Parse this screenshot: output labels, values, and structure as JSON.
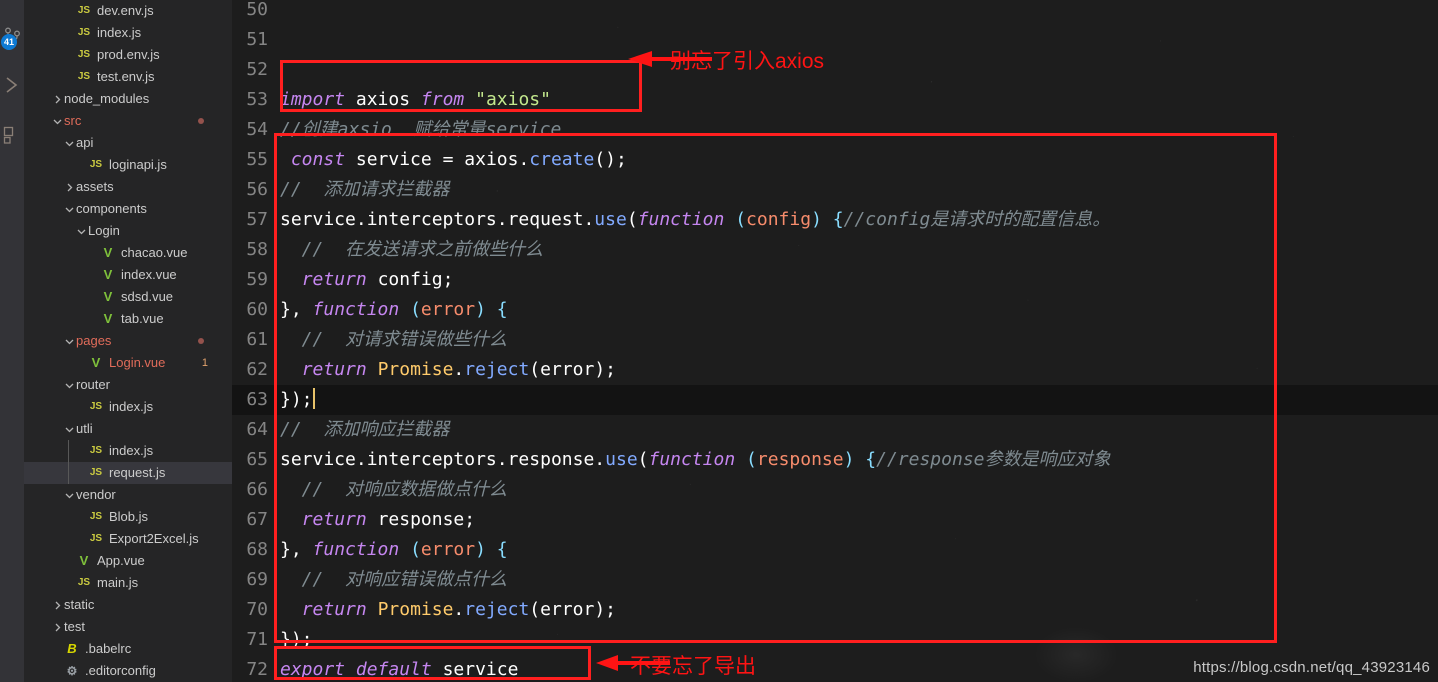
{
  "activity_bar": {
    "items": [
      {
        "name": "source-control-icon",
        "badge": "41"
      },
      {
        "name": "run-debug-icon",
        "badge": ""
      },
      {
        "name": "extensions-icon",
        "badge": ""
      }
    ]
  },
  "sidebar": {
    "items": [
      {
        "label": "dev.env.js",
        "indent": 3,
        "icon": "js",
        "twisty": "",
        "state": "",
        "badge": "",
        "dot": false
      },
      {
        "label": "index.js",
        "indent": 3,
        "icon": "js",
        "twisty": "",
        "state": "",
        "badge": "",
        "dot": false
      },
      {
        "label": "prod.env.js",
        "indent": 3,
        "icon": "js",
        "twisty": "",
        "state": "",
        "badge": "",
        "dot": false
      },
      {
        "label": "test.env.js",
        "indent": 3,
        "icon": "js",
        "twisty": "",
        "state": "",
        "badge": "",
        "dot": false
      },
      {
        "label": "node_modules",
        "indent": 2,
        "icon": "",
        "twisty": "collapsed",
        "state": "",
        "badge": "",
        "dot": false
      },
      {
        "label": "src",
        "indent": 2,
        "icon": "",
        "twisty": "expanded",
        "state": "gitmod",
        "badge": "",
        "dot": true
      },
      {
        "label": "api",
        "indent": 3,
        "icon": "",
        "twisty": "expanded",
        "state": "",
        "badge": "",
        "dot": false
      },
      {
        "label": "loginapi.js",
        "indent": 4,
        "icon": "js",
        "twisty": "",
        "state": "",
        "badge": "",
        "dot": false
      },
      {
        "label": "assets",
        "indent": 3,
        "icon": "",
        "twisty": "collapsed",
        "state": "",
        "badge": "",
        "dot": false
      },
      {
        "label": "components",
        "indent": 3,
        "icon": "",
        "twisty": "expanded",
        "state": "",
        "badge": "",
        "dot": false
      },
      {
        "label": "Login",
        "indent": 4,
        "icon": "",
        "twisty": "expanded",
        "state": "",
        "badge": "",
        "dot": false
      },
      {
        "label": "chacao.vue",
        "indent": 5,
        "icon": "vue",
        "twisty": "",
        "state": "",
        "badge": "",
        "dot": false
      },
      {
        "label": "index.vue",
        "indent": 5,
        "icon": "vue",
        "twisty": "",
        "state": "",
        "badge": "",
        "dot": false
      },
      {
        "label": "sdsd.vue",
        "indent": 5,
        "icon": "vue",
        "twisty": "",
        "state": "",
        "badge": "",
        "dot": false
      },
      {
        "label": "tab.vue",
        "indent": 5,
        "icon": "vue",
        "twisty": "",
        "state": "",
        "badge": "",
        "dot": false
      },
      {
        "label": "pages",
        "indent": 3,
        "icon": "",
        "twisty": "expanded",
        "state": "gitmod",
        "badge": "",
        "dot": true
      },
      {
        "label": "Login.vue",
        "indent": 4,
        "icon": "vue",
        "twisty": "",
        "state": "gitmod",
        "badge": "1",
        "dot": false
      },
      {
        "label": "router",
        "indent": 3,
        "icon": "",
        "twisty": "expanded",
        "state": "",
        "badge": "",
        "dot": false
      },
      {
        "label": "index.js",
        "indent": 4,
        "icon": "js",
        "twisty": "",
        "state": "",
        "badge": "",
        "dot": false
      },
      {
        "label": "utli",
        "indent": 3,
        "icon": "",
        "twisty": "expanded",
        "state": "",
        "badge": "",
        "dot": false
      },
      {
        "label": "index.js",
        "indent": 4,
        "icon": "js",
        "twisty": "",
        "state": "",
        "badge": "",
        "dot": false
      },
      {
        "label": "request.js",
        "indent": 4,
        "icon": "js",
        "twisty": "",
        "state": "selected",
        "badge": "",
        "dot": false
      },
      {
        "label": "vendor",
        "indent": 3,
        "icon": "",
        "twisty": "expanded",
        "state": "",
        "badge": "",
        "dot": false
      },
      {
        "label": "Blob.js",
        "indent": 4,
        "icon": "js",
        "twisty": "",
        "state": "",
        "badge": "",
        "dot": false
      },
      {
        "label": "Export2Excel.js",
        "indent": 4,
        "icon": "js",
        "twisty": "",
        "state": "",
        "badge": "",
        "dot": false
      },
      {
        "label": "App.vue",
        "indent": 3,
        "icon": "vue",
        "twisty": "",
        "state": "",
        "badge": "",
        "dot": false
      },
      {
        "label": "main.js",
        "indent": 3,
        "icon": "js",
        "twisty": "",
        "state": "",
        "badge": "",
        "dot": false
      },
      {
        "label": "static",
        "indent": 2,
        "icon": "",
        "twisty": "collapsed",
        "state": "",
        "badge": "",
        "dot": false
      },
      {
        "label": "test",
        "indent": 2,
        "icon": "",
        "twisty": "collapsed",
        "state": "",
        "badge": "",
        "dot": false
      },
      {
        "label": ".babelrc",
        "indent": 2,
        "icon": "babel",
        "twisty": "",
        "state": "",
        "badge": "",
        "dot": false
      },
      {
        "label": ".editorconfig",
        "indent": 2,
        "icon": "gear",
        "twisty": "",
        "state": "",
        "badge": "",
        "dot": false
      }
    ]
  },
  "editor": {
    "current_line": 63,
    "lines": [
      {
        "no": "50",
        "tokens": []
      },
      {
        "no": "51",
        "tokens": []
      },
      {
        "no": "52",
        "tokens": []
      },
      {
        "no": "53",
        "tokens": [
          {
            "t": "import",
            "c": "kw"
          },
          {
            "t": " ",
            "c": "op"
          },
          {
            "t": "axios",
            "c": "plain"
          },
          {
            "t": " ",
            "c": "op"
          },
          {
            "t": "from",
            "c": "kw"
          },
          {
            "t": " ",
            "c": "op"
          },
          {
            "t": "\"axios\"",
            "c": "str"
          }
        ]
      },
      {
        "no": "54",
        "tokens": [
          {
            "t": "//创建axsio  赋给常量service",
            "c": "cmt"
          }
        ]
      },
      {
        "no": "55",
        "tokens": [
          {
            "t": " ",
            "c": "op"
          },
          {
            "t": "const",
            "c": "kw"
          },
          {
            "t": " ",
            "c": "op"
          },
          {
            "t": "service",
            "c": "plain"
          },
          {
            "t": " ",
            "c": "op"
          },
          {
            "t": "=",
            "c": "op"
          },
          {
            "t": " ",
            "c": "op"
          },
          {
            "t": "axios",
            "c": "plain"
          },
          {
            "t": ".",
            "c": "op"
          },
          {
            "t": "create",
            "c": "fn"
          },
          {
            "t": "();",
            "c": "plain"
          }
        ]
      },
      {
        "no": "56",
        "tokens": [
          {
            "t": "//  添加请求拦截器",
            "c": "cmt"
          }
        ]
      },
      {
        "no": "57",
        "tokens": [
          {
            "t": "service",
            "c": "plain"
          },
          {
            "t": ".",
            "c": "op"
          },
          {
            "t": "interceptors",
            "c": "plain"
          },
          {
            "t": ".",
            "c": "op"
          },
          {
            "t": "request",
            "c": "plain"
          },
          {
            "t": ".",
            "c": "op"
          },
          {
            "t": "use",
            "c": "fn"
          },
          {
            "t": "(",
            "c": "plain"
          },
          {
            "t": "function",
            "c": "kw"
          },
          {
            "t": " ",
            "c": "op"
          },
          {
            "t": "(",
            "c": "punc"
          },
          {
            "t": "config",
            "c": "param"
          },
          {
            "t": ")",
            "c": "punc"
          },
          {
            "t": " ",
            "c": "op"
          },
          {
            "t": "{",
            "c": "punc"
          },
          {
            "t": "//config是请求时的配置信息。",
            "c": "cmt"
          }
        ]
      },
      {
        "no": "58",
        "tokens": [
          {
            "t": "  //  在发送请求之前做些什么",
            "c": "cmt"
          }
        ]
      },
      {
        "no": "59",
        "tokens": [
          {
            "t": "  ",
            "c": "op"
          },
          {
            "t": "return",
            "c": "kw"
          },
          {
            "t": " ",
            "c": "op"
          },
          {
            "t": "config",
            "c": "plain"
          },
          {
            "t": ";",
            "c": "plain"
          }
        ]
      },
      {
        "no": "60",
        "tokens": [
          {
            "t": "}, ",
            "c": "plain"
          },
          {
            "t": "function",
            "c": "kw"
          },
          {
            "t": " ",
            "c": "op"
          },
          {
            "t": "(",
            "c": "punc"
          },
          {
            "t": "error",
            "c": "param"
          },
          {
            "t": ")",
            "c": "punc"
          },
          {
            "t": " ",
            "c": "op"
          },
          {
            "t": "{",
            "c": "punc"
          }
        ]
      },
      {
        "no": "61",
        "tokens": [
          {
            "t": "  //  对请求错误做些什么",
            "c": "cmt"
          }
        ]
      },
      {
        "no": "62",
        "tokens": [
          {
            "t": "  ",
            "c": "op"
          },
          {
            "t": "return",
            "c": "kw"
          },
          {
            "t": " ",
            "c": "op"
          },
          {
            "t": "Promise",
            "c": "cls"
          },
          {
            "t": ".",
            "c": "op"
          },
          {
            "t": "reject",
            "c": "fn"
          },
          {
            "t": "(error);",
            "c": "plain"
          }
        ]
      },
      {
        "no": "63",
        "tokens": [
          {
            "t": "});",
            "c": "plain"
          }
        ],
        "cursor": true
      },
      {
        "no": "64",
        "tokens": [
          {
            "t": "//  添加响应拦截器",
            "c": "cmt"
          }
        ]
      },
      {
        "no": "65",
        "tokens": [
          {
            "t": "service",
            "c": "plain"
          },
          {
            "t": ".",
            "c": "op"
          },
          {
            "t": "interceptors",
            "c": "plain"
          },
          {
            "t": ".",
            "c": "op"
          },
          {
            "t": "response",
            "c": "plain"
          },
          {
            "t": ".",
            "c": "op"
          },
          {
            "t": "use",
            "c": "fn"
          },
          {
            "t": "(",
            "c": "plain"
          },
          {
            "t": "function",
            "c": "kw"
          },
          {
            "t": " ",
            "c": "op"
          },
          {
            "t": "(",
            "c": "punc"
          },
          {
            "t": "response",
            "c": "param"
          },
          {
            "t": ")",
            "c": "punc"
          },
          {
            "t": " ",
            "c": "op"
          },
          {
            "t": "{",
            "c": "punc"
          },
          {
            "t": "//response参数是响应对象",
            "c": "cmt"
          }
        ]
      },
      {
        "no": "66",
        "tokens": [
          {
            "t": "  //  对响应数据做点什么",
            "c": "cmt"
          }
        ]
      },
      {
        "no": "67",
        "tokens": [
          {
            "t": "  ",
            "c": "op"
          },
          {
            "t": "return",
            "c": "kw"
          },
          {
            "t": " ",
            "c": "op"
          },
          {
            "t": "response",
            "c": "plain"
          },
          {
            "t": ";",
            "c": "plain"
          }
        ]
      },
      {
        "no": "68",
        "tokens": [
          {
            "t": "}, ",
            "c": "plain"
          },
          {
            "t": "function",
            "c": "kw"
          },
          {
            "t": " ",
            "c": "op"
          },
          {
            "t": "(",
            "c": "punc"
          },
          {
            "t": "error",
            "c": "param"
          },
          {
            "t": ")",
            "c": "punc"
          },
          {
            "t": " ",
            "c": "op"
          },
          {
            "t": "{",
            "c": "punc"
          }
        ]
      },
      {
        "no": "69",
        "tokens": [
          {
            "t": "  //  对响应错误做点什么",
            "c": "cmt"
          }
        ]
      },
      {
        "no": "70",
        "tokens": [
          {
            "t": "  ",
            "c": "op"
          },
          {
            "t": "return",
            "c": "kw"
          },
          {
            "t": " ",
            "c": "op"
          },
          {
            "t": "Promise",
            "c": "cls"
          },
          {
            "t": ".",
            "c": "op"
          },
          {
            "t": "reject",
            "c": "fn"
          },
          {
            "t": "(error);",
            "c": "plain"
          }
        ]
      },
      {
        "no": "71",
        "tokens": [
          {
            "t": "});",
            "c": "plain"
          }
        ]
      },
      {
        "no": "72",
        "tokens": [
          {
            "t": "export",
            "c": "kw"
          },
          {
            "t": " ",
            "c": "op"
          },
          {
            "t": "default",
            "c": "kw"
          },
          {
            "t": " ",
            "c": "op"
          },
          {
            "t": "service",
            "c": "plain"
          }
        ]
      }
    ]
  },
  "annotations": {
    "color": "#ff1414",
    "note_import": "别忘了引入axios",
    "note_export": "不要忘了导出"
  },
  "watermark": "https://blog.csdn.net/qq_43923146"
}
